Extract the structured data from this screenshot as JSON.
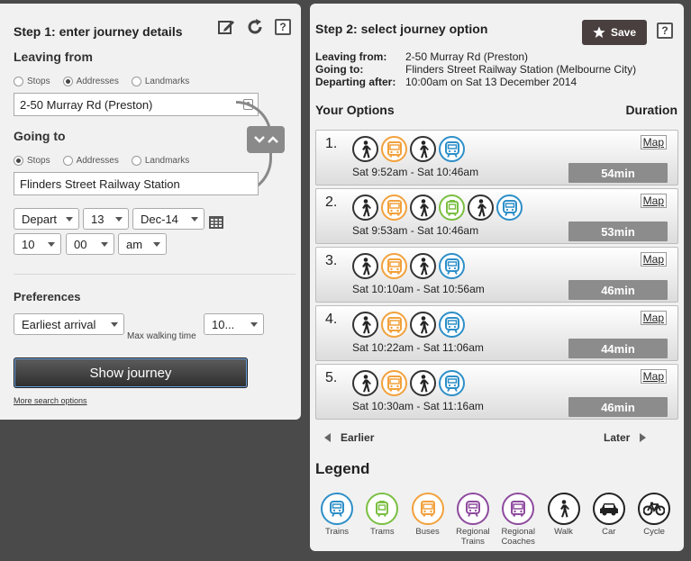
{
  "left": {
    "title": "Step 1: enter journey details",
    "leaving_from": {
      "label": "Leaving from",
      "options": [
        "Stops",
        "Addresses",
        "Landmarks"
      ],
      "selected_index": 1,
      "value": "2-50 Murray Rd (Preston)"
    },
    "going_to": {
      "label": "Going to",
      "options": [
        "Stops",
        "Addresses",
        "Landmarks"
      ],
      "selected_index": 0,
      "value": "Flinders Street Railway Station"
    },
    "depart_mode": "Depart",
    "day": "13",
    "month": "Dec-14",
    "hour": "10",
    "minute": "00",
    "ampm": "am",
    "preferences_label": "Preferences",
    "preference": "Earliest arrival",
    "max_walking_label": "Max walking time",
    "max_walking_value": "10...",
    "show_button": "Show journey",
    "more_options": "More search options"
  },
  "right": {
    "title": "Step 2: select journey option",
    "save_label": "Save",
    "help_label": "?",
    "info": [
      {
        "key": "Leaving from:",
        "value": "2-50 Murray Rd (Preston)"
      },
      {
        "key": "Going to:",
        "value": "Flinders Street Railway Station (Melbourne City)"
      },
      {
        "key": "Departing after:",
        "value": "10:00am on Sat 13 December 2014"
      }
    ],
    "options_heading": "Your Options",
    "duration_heading": "Duration",
    "map_label": "Map",
    "options": [
      {
        "num": "1.",
        "legs": [
          "walk",
          "bus",
          "walk",
          "train"
        ],
        "time": "Sat 9:52am - Sat 10:46am",
        "duration": "54min"
      },
      {
        "num": "2.",
        "legs": [
          "walk",
          "bus",
          "walk",
          "tram",
          "walk",
          "train"
        ],
        "time": "Sat 9:53am - Sat 10:46am",
        "duration": "53min"
      },
      {
        "num": "3.",
        "legs": [
          "walk",
          "bus",
          "walk",
          "train"
        ],
        "time": "Sat 10:10am - Sat 10:56am",
        "duration": "46min"
      },
      {
        "num": "4.",
        "legs": [
          "walk",
          "bus",
          "walk",
          "train"
        ],
        "time": "Sat 10:22am - Sat 11:06am",
        "duration": "44min"
      },
      {
        "num": "5.",
        "legs": [
          "walk",
          "bus",
          "walk",
          "train"
        ],
        "time": "Sat 10:30am - Sat 11:16am",
        "duration": "46min"
      }
    ],
    "earlier_label": "Earlier",
    "later_label": "Later",
    "legend_title": "Legend",
    "legend": [
      {
        "label": "Trains",
        "icon": "train-icon",
        "color": "#2e8fc8"
      },
      {
        "label": "Trams",
        "icon": "tram-icon",
        "color": "#7bbf42"
      },
      {
        "label": "Buses",
        "icon": "bus-icon",
        "color": "#f2a13c"
      },
      {
        "label": "Regional Trains",
        "icon": "regional-train-icon",
        "color": "#8e4b9e"
      },
      {
        "label": "Regional Coaches",
        "icon": "regional-coach-icon",
        "color": "#8e4b9e"
      },
      {
        "label": "Walk",
        "icon": "walk-icon",
        "color": "#222222"
      },
      {
        "label": "Car",
        "icon": "car-icon",
        "color": "#222222"
      },
      {
        "label": "Cycle",
        "icon": "cycle-icon",
        "color": "#222222"
      }
    ]
  }
}
